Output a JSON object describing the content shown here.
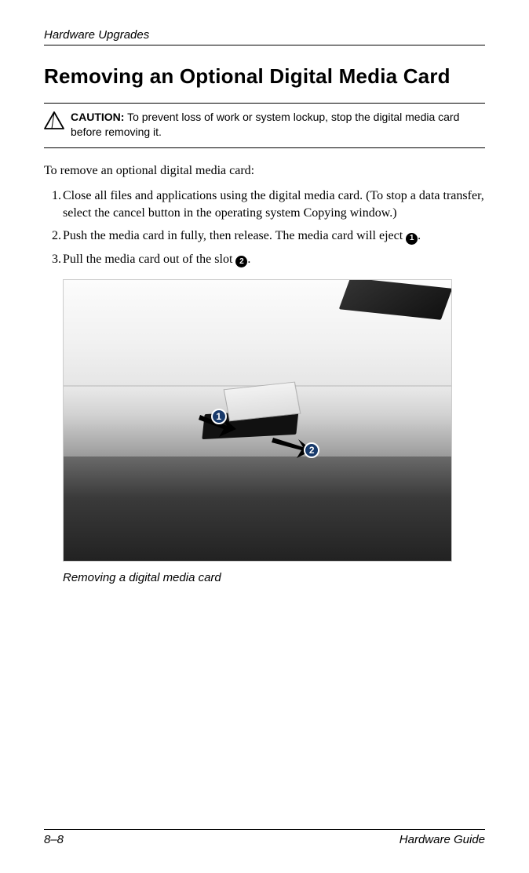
{
  "header": {
    "chapter": "Hardware Upgrades"
  },
  "title": "Removing an Optional Digital Media Card",
  "caution": {
    "label": "CAUTION:",
    "text": " To prevent loss of work or system lockup, stop the digital media card before removing it."
  },
  "lead": "To remove an optional digital media card:",
  "steps": [
    {
      "num": "1.",
      "text_a": "Close all files and applications using the digital media card. (To stop a data transfer, select the cancel button in the operating system Copying window.)"
    },
    {
      "num": "2.",
      "text_a": "Push the media card in fully, then release. The media card will eject ",
      "ref": "1",
      "text_b": "."
    },
    {
      "num": "3.",
      "text_a": "Pull the media card out of the slot ",
      "ref": "2",
      "text_b": "."
    }
  ],
  "figure": {
    "callout1": "1",
    "callout2": "2",
    "caption": "Removing a digital media card"
  },
  "footer": {
    "page": "8–8",
    "doc": "Hardware Guide"
  }
}
